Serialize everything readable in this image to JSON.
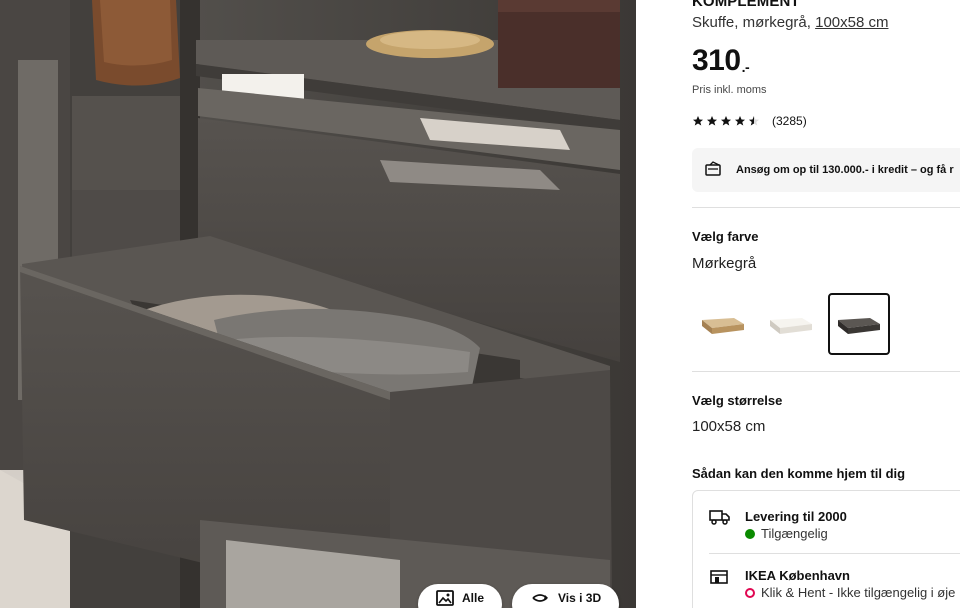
{
  "product": {
    "name": "KOMPLEMENT",
    "desc_prefix": "Skuffe, mørkegrå, ",
    "desc_size": "100x58 cm",
    "price_int": "310",
    "price_dec": ".-",
    "vat_note": "Pris inkl. moms",
    "rating": {
      "stars": 4.5,
      "max": 5,
      "count": "(3285)"
    }
  },
  "credit_banner": {
    "text": "Ansøg om op til 130.000.- i kredit – og få r",
    "icon": "credit-card-icon"
  },
  "color": {
    "title": "Vælg farve",
    "value": "Mørkegrå",
    "swatches": [
      {
        "name": "white-stained-oak",
        "color": "#c9a97c",
        "selected": false
      },
      {
        "name": "white",
        "color": "#ece9e2",
        "selected": false
      },
      {
        "name": "dark-grey",
        "color": "#3d3a37",
        "selected": true
      }
    ]
  },
  "size": {
    "title": "Vælg størrelse",
    "value": "100x58 cm"
  },
  "delivery": {
    "title": "Sådan kan den komme hjem til dig",
    "options": [
      {
        "title": "Levering til 2000",
        "status": "Tilgængelig",
        "status_color": "#0a8a00",
        "icon": "truck-icon"
      },
      {
        "title": "IKEA København",
        "status": "Klik & Hent - Ikke tilgængelig i øje",
        "status_color": "#e00751",
        "icon": "store-icon"
      }
    ]
  },
  "media_buttons": {
    "all": "Alle",
    "view3d": "Vis i 3D"
  }
}
